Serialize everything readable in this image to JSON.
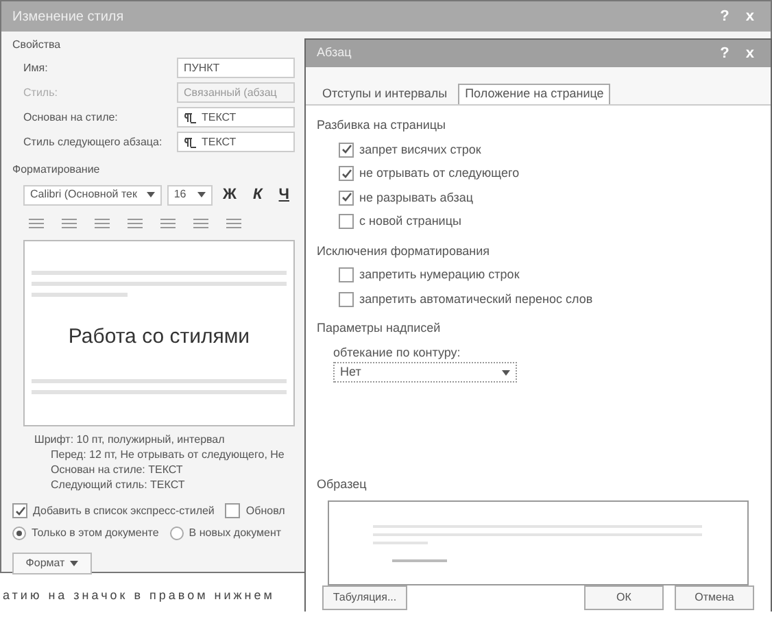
{
  "back_dialog": {
    "title": "Изменение стиля",
    "title_buttons": [
      "?",
      "x"
    ],
    "properties_heading": "Свойства",
    "fields": [
      {
        "label": "Имя:",
        "value": "ПУНКТ",
        "kind": "text",
        "disabled": false
      },
      {
        "label": "Стиль:",
        "value": "Связанный (абзац",
        "kind": "text",
        "disabled": true
      },
      {
        "label": "Основан на стиле:",
        "value": "ТЕКСТ",
        "kind": "style",
        "disabled": false
      },
      {
        "label": "Стиль следующего абзаца:",
        "value": "ТЕКСТ",
        "kind": "style",
        "disabled": false
      }
    ],
    "formatting_heading": "Форматирование",
    "font": "Calibri (Основной тек",
    "size": "16",
    "font_buttons": [
      "Ж",
      "К",
      "Ч"
    ],
    "preview_title": "Работа со стилями",
    "description": [
      "Шрифт: 10 пт, полужирный, интервал",
      "Перед:  12 пт, Не отрывать от следующего, Не",
      "Основан на стиле: ТЕКСТ",
      "Следующий стиль: ТЕКСТ"
    ],
    "checkboxes": [
      {
        "label": "Добавить в список экспресс-стилей",
        "checked": true
      },
      {
        "label": "Обновл",
        "checked": false
      }
    ],
    "radios": [
      {
        "label": "Только в этом документе",
        "selected": true
      },
      {
        "label": "В новых документ",
        "selected": false
      }
    ],
    "format_button": "Формат"
  },
  "front_dialog": {
    "title": "Абзац",
    "title_buttons": [
      "?",
      "x"
    ],
    "tabs": [
      {
        "label": "Отступы и интервалы",
        "selected": false
      },
      {
        "label": "Положение на странице",
        "selected": true
      }
    ],
    "sections": [
      {
        "heading": "Разбивка на страницы",
        "options": [
          {
            "label": "запрет висячих строк",
            "checked": true
          },
          {
            "label": "не отрывать от следующего",
            "checked": true
          },
          {
            "label": "не разрывать абзац",
            "checked": true
          },
          {
            "label": "с новой страницы",
            "checked": false
          }
        ]
      },
      {
        "heading": "Исключения форматирования",
        "options": [
          {
            "label": "запретить нумерацию строк",
            "checked": false
          },
          {
            "label": "запретить автоматический перенос слов",
            "checked": false
          }
        ]
      }
    ],
    "textbox_heading": "Параметры надписей",
    "wrap_label": "обтекание по контуру:",
    "wrap_value": "Нет",
    "sample_heading": "Образец",
    "buttons": [
      {
        "label": "Табуляция...",
        "kind": "left"
      },
      {
        "label": "ОК",
        "kind": "right"
      },
      {
        "label": "Отмена",
        "kind": "right"
      }
    ]
  },
  "page_text": "атию на значок в правом нижнем"
}
